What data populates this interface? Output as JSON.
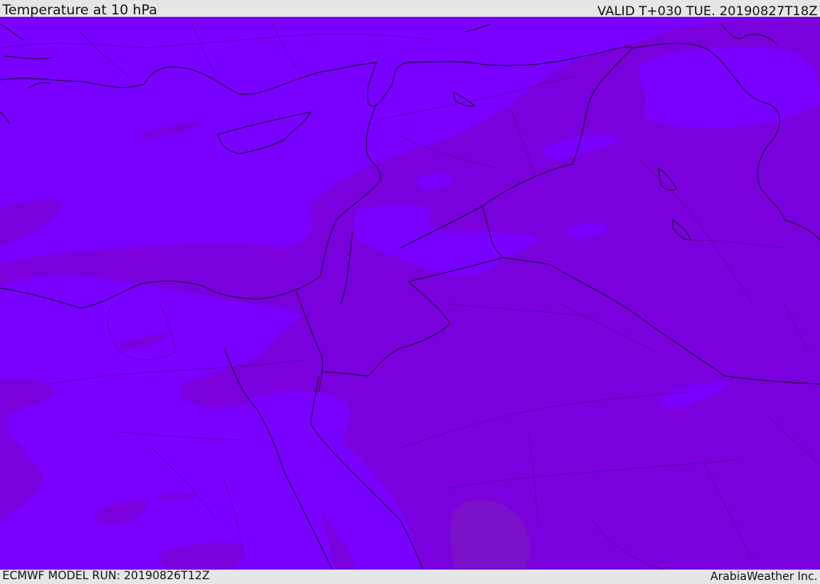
{
  "header": {
    "title": "Temperature at 10 hPa",
    "valid_time": "VALID T+030 TUE. 20190827T18Z"
  },
  "footer": {
    "model_run": "ECMWF MODEL RUN: 20190826T12Z",
    "credit": "ArabiaWeather Inc."
  },
  "colors": {
    "warmer_band": "#7a00ff",
    "cooler_band": "#7a00dd",
    "deep_patch": "#7a10c8",
    "border_line": "#1a0033",
    "chrome": "#e6e6e6"
  }
}
